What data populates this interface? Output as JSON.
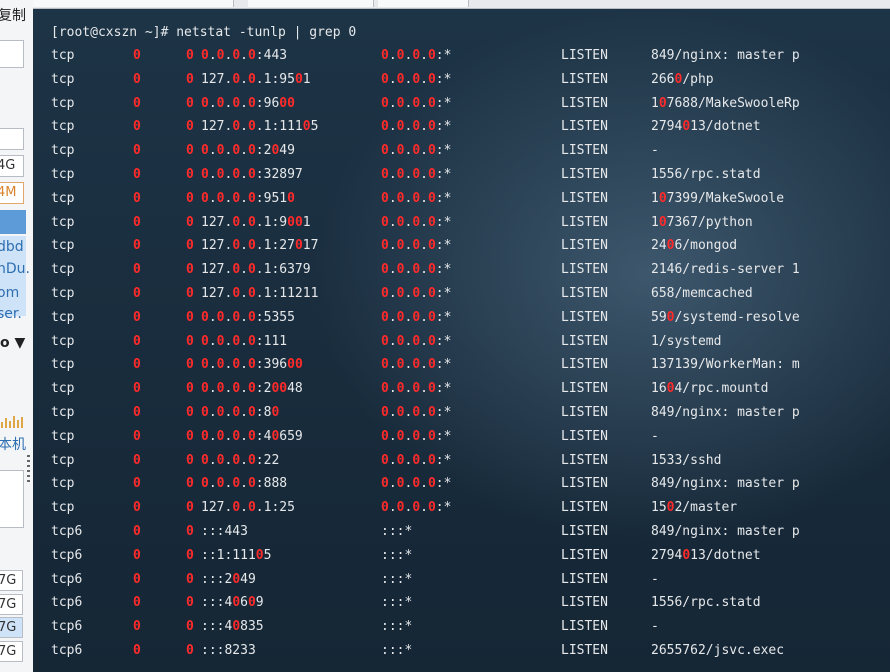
{
  "left_panel": {
    "top_label": "复制",
    "boxes": [
      "4G",
      "4M"
    ],
    "items": [
      "dbd",
      "nDu.",
      "om",
      "ser."
    ],
    "dropdown_label": "o ▼",
    "machine_label": "本机",
    "bottom_values": [
      "7G",
      "7G",
      "7G",
      "7G"
    ]
  },
  "terminal": {
    "command": "[root@cxszn ~]# netstat -tunlp | grep 0",
    "highlight_char": "0",
    "rows": [
      {
        "proto": "tcp",
        "recv_q": "0",
        "send_q": "0",
        "local": "0.0.0.0:443",
        "foreign": "0.0.0.0:*",
        "state": "LISTEN",
        "pid": "849/nginx: master p"
      },
      {
        "proto": "tcp",
        "recv_q": "0",
        "send_q": "0",
        "local": "127.0.0.1:9501",
        "foreign": "0.0.0.0:*",
        "state": "LISTEN",
        "pid": "2660/php"
      },
      {
        "proto": "tcp",
        "recv_q": "0",
        "send_q": "0",
        "local": "0.0.0.0:9600",
        "foreign": "0.0.0.0:*",
        "state": "LISTEN",
        "pid": "107688/MakeSwooleRp"
      },
      {
        "proto": "tcp",
        "recv_q": "0",
        "send_q": "0",
        "local": "127.0.0.1:11105",
        "foreign": "0.0.0.0:*",
        "state": "LISTEN",
        "pid": "2794013/dotnet"
      },
      {
        "proto": "tcp",
        "recv_q": "0",
        "send_q": "0",
        "local": "0.0.0.0:2049",
        "foreign": "0.0.0.0:*",
        "state": "LISTEN",
        "pid": "-"
      },
      {
        "proto": "tcp",
        "recv_q": "0",
        "send_q": "0",
        "local": "0.0.0.0:32897",
        "foreign": "0.0.0.0:*",
        "state": "LISTEN",
        "pid": "1556/rpc.statd"
      },
      {
        "proto": "tcp",
        "recv_q": "0",
        "send_q": "0",
        "local": "0.0.0.0:9510",
        "foreign": "0.0.0.0:*",
        "state": "LISTEN",
        "pid": "107399/MakeSwoole"
      },
      {
        "proto": "tcp",
        "recv_q": "0",
        "send_q": "0",
        "local": "127.0.0.1:9001",
        "foreign": "0.0.0.0:*",
        "state": "LISTEN",
        "pid": "107367/python"
      },
      {
        "proto": "tcp",
        "recv_q": "0",
        "send_q": "0",
        "local": "127.0.0.1:27017",
        "foreign": "0.0.0.0:*",
        "state": "LISTEN",
        "pid": "2406/mongod"
      },
      {
        "proto": "tcp",
        "recv_q": "0",
        "send_q": "0",
        "local": "127.0.0.1:6379",
        "foreign": "0.0.0.0:*",
        "state": "LISTEN",
        "pid": "2146/redis-server 1"
      },
      {
        "proto": "tcp",
        "recv_q": "0",
        "send_q": "0",
        "local": "127.0.0.1:11211",
        "foreign": "0.0.0.0:*",
        "state": "LISTEN",
        "pid": "658/memcached"
      },
      {
        "proto": "tcp",
        "recv_q": "0",
        "send_q": "0",
        "local": "0.0.0.0:5355",
        "foreign": "0.0.0.0:*",
        "state": "LISTEN",
        "pid": "590/systemd-resolve"
      },
      {
        "proto": "tcp",
        "recv_q": "0",
        "send_q": "0",
        "local": "0.0.0.0:111",
        "foreign": "0.0.0.0:*",
        "state": "LISTEN",
        "pid": "1/systemd"
      },
      {
        "proto": "tcp",
        "recv_q": "0",
        "send_q": "0",
        "local": "0.0.0.0:39600",
        "foreign": "0.0.0.0:*",
        "state": "LISTEN",
        "pid": "137139/WorkerMan: m"
      },
      {
        "proto": "tcp",
        "recv_q": "0",
        "send_q": "0",
        "local": "0.0.0.0:20048",
        "foreign": "0.0.0.0:*",
        "state": "LISTEN",
        "pid": "1604/rpc.mountd"
      },
      {
        "proto": "tcp",
        "recv_q": "0",
        "send_q": "0",
        "local": "0.0.0.0:80",
        "foreign": "0.0.0.0:*",
        "state": "LISTEN",
        "pid": "849/nginx: master p"
      },
      {
        "proto": "tcp",
        "recv_q": "0",
        "send_q": "0",
        "local": "0.0.0.0:40659",
        "foreign": "0.0.0.0:*",
        "state": "LISTEN",
        "pid": "-"
      },
      {
        "proto": "tcp",
        "recv_q": "0",
        "send_q": "0",
        "local": "0.0.0.0:22",
        "foreign": "0.0.0.0:*",
        "state": "LISTEN",
        "pid": "1533/sshd"
      },
      {
        "proto": "tcp",
        "recv_q": "0",
        "send_q": "0",
        "local": "0.0.0.0:888",
        "foreign": "0.0.0.0:*",
        "state": "LISTEN",
        "pid": "849/nginx: master p"
      },
      {
        "proto": "tcp",
        "recv_q": "0",
        "send_q": "0",
        "local": "127.0.0.1:25",
        "foreign": "0.0.0.0:*",
        "state": "LISTEN",
        "pid": "1502/master"
      },
      {
        "proto": "tcp6",
        "recv_q": "0",
        "send_q": "0",
        "local": ":::443",
        "foreign": ":::*",
        "state": "LISTEN",
        "pid": "849/nginx: master p"
      },
      {
        "proto": "tcp6",
        "recv_q": "0",
        "send_q": "0",
        "local": "::1:11105",
        "foreign": ":::*",
        "state": "LISTEN",
        "pid": "2794013/dotnet"
      },
      {
        "proto": "tcp6",
        "recv_q": "0",
        "send_q": "0",
        "local": ":::2049",
        "foreign": ":::*",
        "state": "LISTEN",
        "pid": "-"
      },
      {
        "proto": "tcp6",
        "recv_q": "0",
        "send_q": "0",
        "local": ":::40609",
        "foreign": ":::*",
        "state": "LISTEN",
        "pid": "1556/rpc.statd"
      },
      {
        "proto": "tcp6",
        "recv_q": "0",
        "send_q": "0",
        "local": ":::40835",
        "foreign": ":::*",
        "state": "LISTEN",
        "pid": "-"
      },
      {
        "proto": "tcp6",
        "recv_q": "0",
        "send_q": "0",
        "local": ":::8233",
        "foreign": ":::*",
        "state": "LISTEN",
        "pid": "2655762/jsvc.exec"
      }
    ]
  },
  "colors": {
    "terminal_bg": "#1a2e3f",
    "terminal_text": "#e6e8ea",
    "grep_match": "#ff2a2a"
  }
}
